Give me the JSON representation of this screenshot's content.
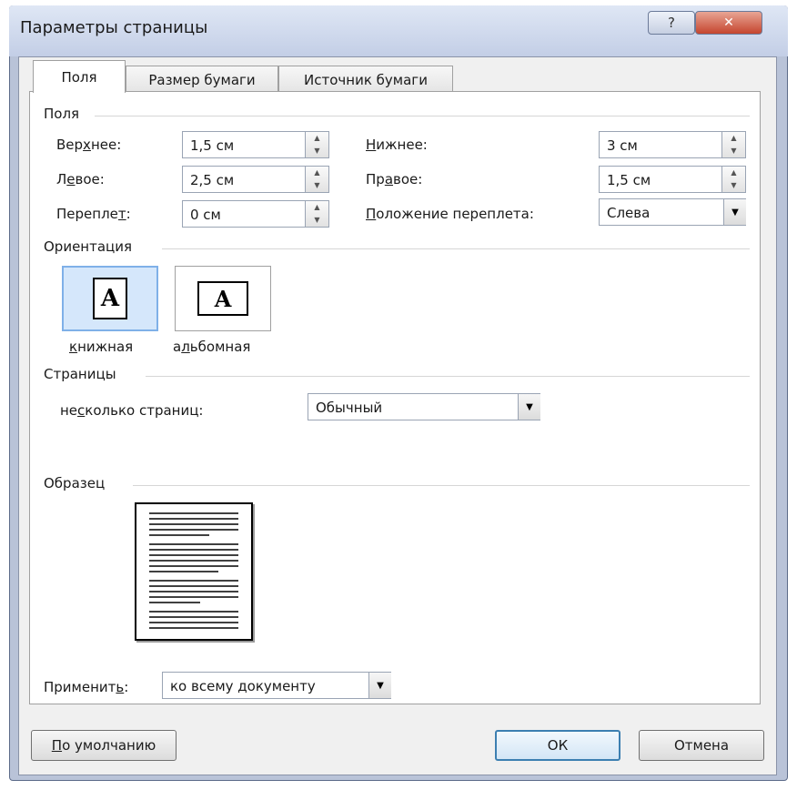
{
  "window": {
    "title": "Параметры страницы",
    "help_glyph": "?",
    "close_glyph": "✕"
  },
  "tabs": [
    {
      "label": "Поля"
    },
    {
      "label": "Размер бумаги"
    },
    {
      "label": "Источник бумаги"
    }
  ],
  "margins": {
    "group": "Поля",
    "top": {
      "label_pre": "Вер",
      "label_key": "х",
      "label_post": "нее:",
      "value": "1,5 см"
    },
    "left": {
      "label_pre": "Л",
      "label_key": "е",
      "label_post": "вое:",
      "value": "2,5 см"
    },
    "gutter": {
      "label_pre": "Перепле",
      "label_key": "т",
      "label_post": ":",
      "value": "0 см"
    },
    "bottom": {
      "label_pre": "",
      "label_key": "Н",
      "label_post": "ижнее:",
      "value": "3 см"
    },
    "right": {
      "label_pre": "Пр",
      "label_key": "а",
      "label_post": "вое:",
      "value": "1,5 см"
    },
    "gutter_pos": {
      "label_pre": "",
      "label_key": "П",
      "label_post": "оложение переплета:",
      "value": "Слева"
    }
  },
  "orientation": {
    "group": "Ориентация",
    "portrait": {
      "label_key": "к",
      "label_post": "нижная"
    },
    "landscape": {
      "label_pre": "а",
      "label_key": "л",
      "label_post": "ьбомная"
    },
    "glyph": "A"
  },
  "pages": {
    "group": "Страницы",
    "multi_label_pre": "не",
    "multi_label_key": "с",
    "multi_label_post": "колько страниц:",
    "multi_value": "Обычный"
  },
  "sample": {
    "group": "Образец"
  },
  "apply": {
    "label_pre": "Применит",
    "label_key": "ь",
    "label_post": ":",
    "value": "ко всему документу"
  },
  "buttons": {
    "default_key": "П",
    "default_post": "о умолчанию",
    "ok": "ОК",
    "cancel": "Отмена"
  }
}
